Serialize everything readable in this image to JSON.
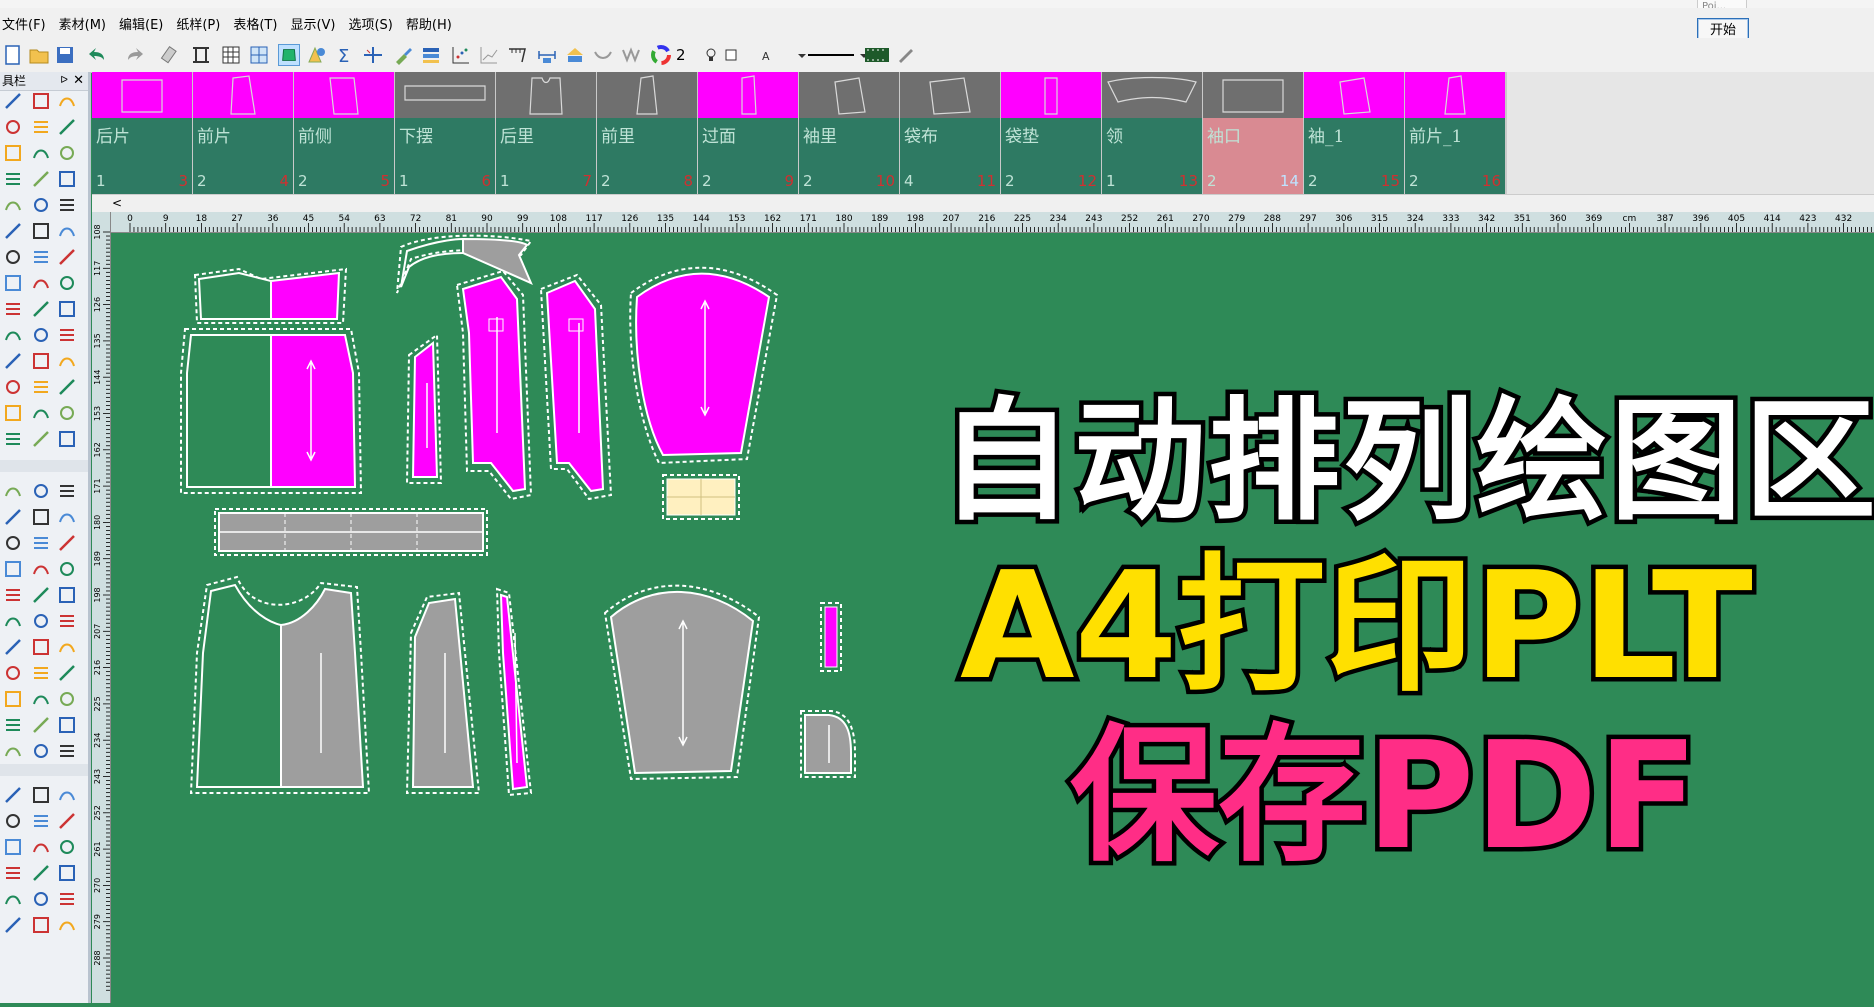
{
  "menu": [
    "文件(F)",
    "素材(M)",
    "编辑(E)",
    "纸样(P)",
    "表格(T)",
    "显示(V)",
    "选项(S)",
    "帮助(H)"
  ],
  "toolbar": {
    "line_width_value": "2",
    "start_label": "开始",
    "popup_stub": "Poi..."
  },
  "left_panel": {
    "title": "具栏",
    "pin": "ᐅ",
    "close": "✕"
  },
  "pieces": [
    {
      "name": "后片",
      "qty": "1",
      "idx": "3",
      "thumb": "magenta"
    },
    {
      "name": "前片",
      "qty": "2",
      "idx": "4",
      "thumb": "magenta"
    },
    {
      "name": "前侧",
      "qty": "2",
      "idx": "5",
      "thumb": "magenta"
    },
    {
      "name": "下摆",
      "qty": "1",
      "idx": "6",
      "thumb": "gray"
    },
    {
      "name": "后里",
      "qty": "1",
      "idx": "7",
      "thumb": "gray"
    },
    {
      "name": "前里",
      "qty": "2",
      "idx": "8",
      "thumb": "gray"
    },
    {
      "name": "过面",
      "qty": "2",
      "idx": "9",
      "thumb": "magenta"
    },
    {
      "name": "袖里",
      "qty": "2",
      "idx": "10",
      "thumb": "gray"
    },
    {
      "name": "袋布",
      "qty": "4",
      "idx": "11",
      "thumb": "gray"
    },
    {
      "name": "袋垫",
      "qty": "2",
      "idx": "12",
      "thumb": "magenta"
    },
    {
      "name": "领",
      "qty": "1",
      "idx": "13",
      "thumb": "gray"
    },
    {
      "name": "袖口",
      "qty": "2",
      "idx": "14",
      "thumb": "gray",
      "selected": true
    },
    {
      "name": "袖_1",
      "qty": "2",
      "idx": "15",
      "thumb": "magenta"
    },
    {
      "name": "前片_1",
      "qty": "2",
      "idx": "16",
      "thumb": "magenta"
    }
  ],
  "scroll_arrow": "<",
  "ruler_top_labels": [
    "0",
    "9",
    "18",
    "27",
    "36",
    "45",
    "54",
    "63",
    "72",
    "81",
    "90",
    "99",
    "108",
    "117",
    "126",
    "135",
    "144",
    "153",
    "162",
    "171",
    "180",
    "189",
    "198",
    "207",
    "216",
    "225",
    "234",
    "243",
    "252",
    "261",
    "270",
    "279",
    "288",
    "297",
    "306",
    "315",
    "324",
    "333",
    "342",
    "351",
    "360",
    "369",
    "cm",
    "387",
    "396",
    "405",
    "414",
    "423",
    "432"
  ],
  "ruler_left_labels": [
    "108",
    "117",
    "126",
    "135",
    "144",
    "153",
    "162",
    "171",
    "180",
    "189",
    "198",
    "207",
    "216",
    "225",
    "234",
    "243",
    "252",
    "261",
    "270",
    "279",
    "288"
  ],
  "overlay": {
    "line1": "自动排列绘图区",
    "line2": "A4打印PLT",
    "line3": "保存PDF"
  },
  "colors": {
    "canvas": "#2e8a57",
    "piece_magenta": "#ff00ff",
    "piece_gray": "#9e9e9e",
    "piece_cream": "#fff0c0",
    "card_bg": "#2e7a63",
    "card_selected": "#d98a92"
  }
}
